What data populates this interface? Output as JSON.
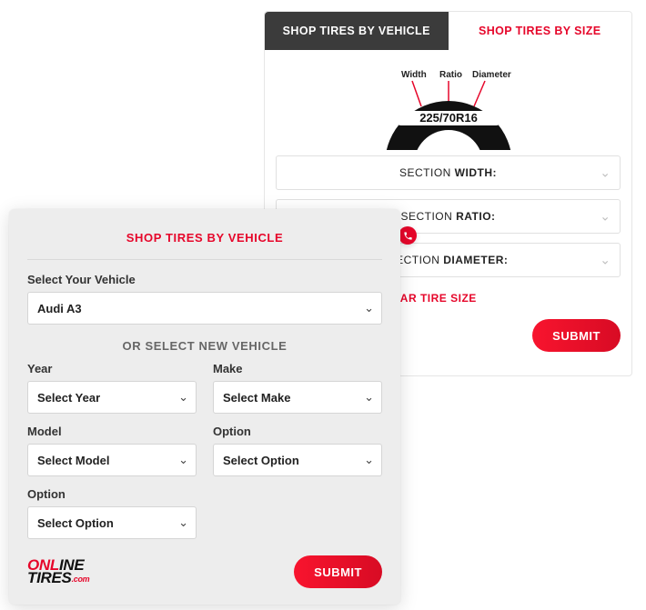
{
  "tabs": {
    "vehicle": "SHOP TIRES BY VEHICLE",
    "size": "SHOP TIRES BY SIZE"
  },
  "tire": {
    "labelWidth": "Width",
    "labelRatio": "Ratio",
    "labelDiameter": "Diameter",
    "inscription": "225/70R16"
  },
  "sizeSelects": {
    "width": {
      "prefix": "SECTION ",
      "bold": "WIDTH:"
    },
    "ratio": {
      "prefix": "SECTION ",
      "bold": "RATIO:"
    },
    "diameter": {
      "prefix": "SECTION ",
      "bold": "DIAMETER:"
    }
  },
  "rearLink": "ADD A DIFFERENT REAR TIRE SIZE",
  "buttons": {
    "submit": "SUBMIT"
  },
  "frontCard": {
    "title": "SHOP TIRES BY VEHICLE",
    "selectVehicleLabel": "Select Your Vehicle",
    "selectedVehicle": "Audi A3",
    "subHeader": "OR SELECT NEW VEHICLE",
    "fields": {
      "year": {
        "label": "Year",
        "value": "Select Year"
      },
      "make": {
        "label": "Make",
        "value": "Select Make"
      },
      "model": {
        "label": "Model",
        "value": "Select Model"
      },
      "option1": {
        "label": "Option",
        "value": "Select Option"
      },
      "option2": {
        "label": "Option",
        "value": "Select Option"
      }
    }
  },
  "logo": {
    "line1a": "ONL",
    "line1b": "INE",
    "line2": "TIRES",
    "suffix": ".com"
  }
}
